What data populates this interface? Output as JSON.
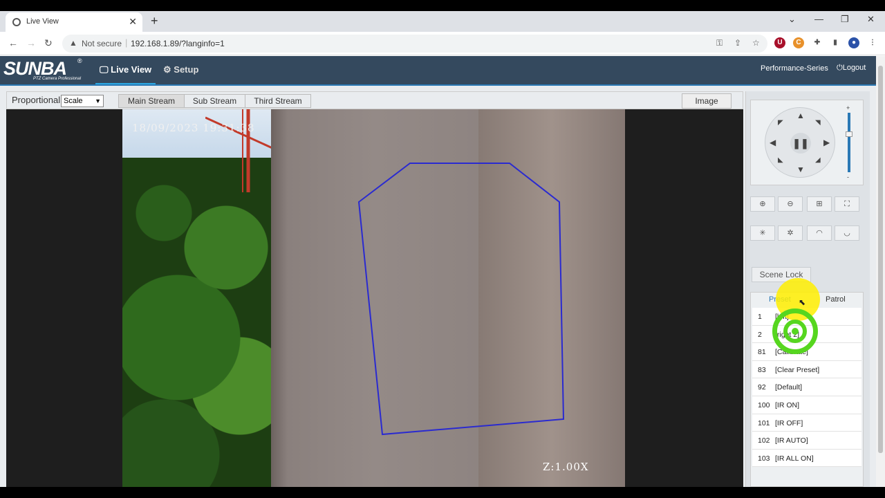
{
  "browser": {
    "tab_title": "Live View",
    "tab_close": "✕",
    "new_tab": "+",
    "not_secure": "Not secure",
    "url": "192.168.1.89/?langinfo=1",
    "win_min": "—",
    "win_restore": "❐",
    "win_close": "✕",
    "win_dropdown": "⌄"
  },
  "header": {
    "logo": "SUNBA",
    "logo_registered": "®",
    "logo_tagline": "PTZ Camera Professional",
    "nav_live": "Live View",
    "nav_setup": "Setup",
    "series": "Performance-Series",
    "logout": "Logout"
  },
  "toolbar": {
    "proportional_label": "Proportional",
    "scale_value": "Scale",
    "streams": [
      "Main Stream",
      "Sub Stream",
      "Third Stream"
    ],
    "active_stream": "Main Stream",
    "image_button": "Image"
  },
  "video": {
    "timestamp": "18/09/2023 19:31:38",
    "zoom": "Z:1.00X"
  },
  "ptz": {
    "center_label": "❚❚",
    "speed_plus": "+",
    "speed_minus": "-",
    "speed_level": 0.35
  },
  "panel": {
    "scene_lock": "Scene Lock",
    "tab_preset": "Preset",
    "tab_patrol": "Patrol",
    "presets": [
      {
        "num": "1",
        "name": "[left]"
      },
      {
        "num": "2",
        "name": "[right 2]"
      },
      {
        "num": "81",
        "name": "[Calibrate]"
      },
      {
        "num": "83",
        "name": "[Clear Preset]"
      },
      {
        "num": "92",
        "name": "[Default]"
      },
      {
        "num": "100",
        "name": "[IR ON]"
      },
      {
        "num": "101",
        "name": "[IR OFF]"
      },
      {
        "num": "102",
        "name": "[IR AUTO]"
      },
      {
        "num": "103",
        "name": "[IR ALL ON]"
      }
    ]
  },
  "colors": {
    "header_bg": "#34495e",
    "accent": "#2b79b5",
    "roi_line": "#2a2ad0",
    "cursor_highlight": "#ffee00",
    "click_ring": "#56d61f"
  }
}
